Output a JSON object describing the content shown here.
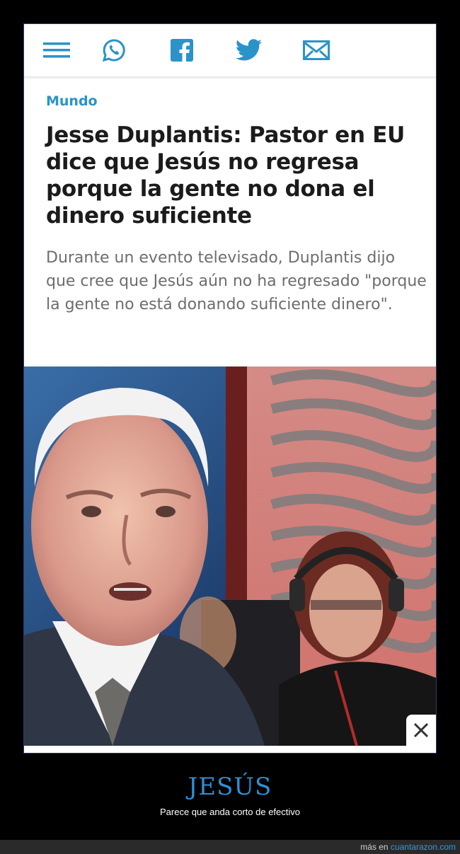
{
  "share_bar": {
    "icons": [
      "menu-icon",
      "whatsapp-icon",
      "facebook-icon",
      "twitter-icon",
      "mail-icon"
    ],
    "icon_color": "#2a93c9"
  },
  "article": {
    "category": "Mundo",
    "headline": "Jesse Duplantis: Pastor en EU dice que Jesús no regresa porque la gente no dona el dinero suficiente",
    "summary": "Durante un evento televisado, Duplantis dijo que cree que Jesús aún no ha regresado \"porque la gente no está donando suficiente dinero\"."
  },
  "close_icon": "close-icon",
  "post": {
    "title": "JESÚS",
    "subtitle": "Parece que anda corto de efectivo"
  },
  "footer": {
    "prefix": "más en",
    "site": "cuantarazon.com"
  }
}
